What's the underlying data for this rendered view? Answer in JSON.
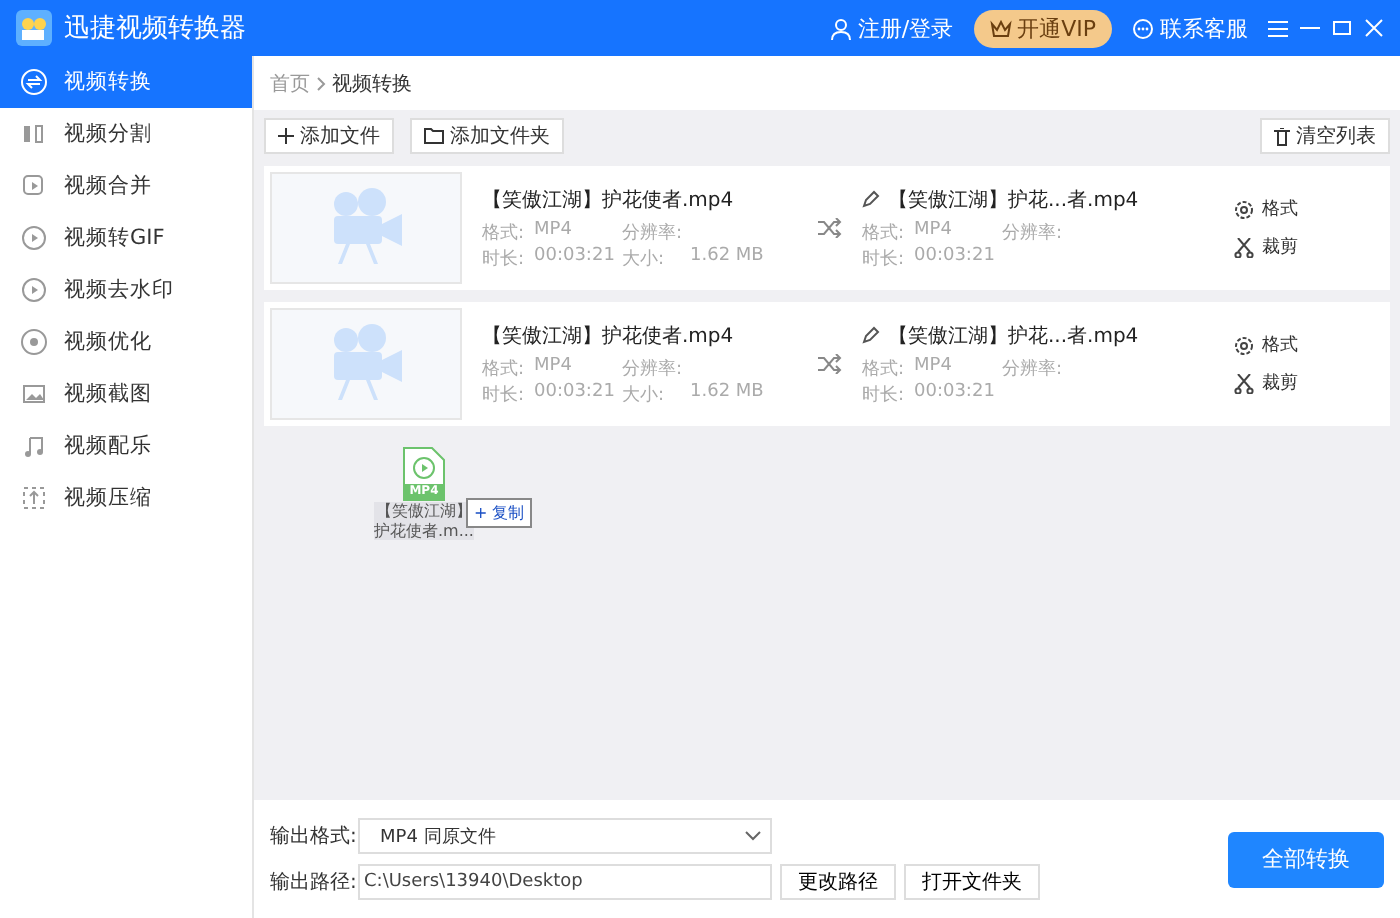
{
  "window": {
    "title": "迅捷视频转换器"
  },
  "header": {
    "login": "注册/登录",
    "vip": "开通VIP",
    "support": "联系客服"
  },
  "sidebar": {
    "items": [
      {
        "label": "视频转换",
        "selected": true
      },
      {
        "label": "视频分割",
        "selected": false
      },
      {
        "label": "视频合并",
        "selected": false
      },
      {
        "label": "视频转GIF",
        "selected": false
      },
      {
        "label": "视频去水印",
        "selected": false
      },
      {
        "label": "视频优化",
        "selected": false
      },
      {
        "label": "视频截图",
        "selected": false
      },
      {
        "label": "视频配乐",
        "selected": false
      },
      {
        "label": "视频压缩",
        "selected": false
      }
    ]
  },
  "breadcrumb": [
    "首页",
    "视频转换"
  ],
  "toolbar": {
    "add_file": "添加文件",
    "add_folder": "添加文件夹",
    "clear": "清空列表"
  },
  "files": [
    {
      "name": "【笑傲江湖】护花使者.mp4",
      "format_label": "格式:",
      "format": "MP4",
      "resolution_label": "分辨率:",
      "duration_label": "时长:",
      "duration": "00:03:21",
      "size_label": "大小:",
      "size": "1.62 MB",
      "output_name": "【笑傲江湖】护花...者.mp4",
      "output_format_label": "格式:",
      "output_format": "MP4",
      "output_resolution_label": "分辨率:",
      "output_duration_label": "时长:",
      "output_duration": "00:03:21",
      "actions": [
        "格式",
        "裁剪"
      ]
    },
    {
      "name": "【笑傲江湖】护花使者.mp4",
      "format_label": "格式:",
      "format": "MP4",
      "resolution_label": "分辨率:",
      "duration_label": "时长:",
      "duration": "00:03:21",
      "size_label": "大小:",
      "size": "1.62 MB",
      "output_name": "【笑傲江湖】护花...者.mp4",
      "output_format_label": "格式:",
      "output_format": "MP4",
      "output_resolution_label": "分辨率:",
      "output_duration_label": "时长:",
      "output_duration": "00:03:21",
      "actions": [
        "格式",
        "裁剪"
      ]
    }
  ],
  "drag": {
    "badge": "MP4",
    "label": [
      "【笑傲江湖】",
      "护花使者.m..."
    ],
    "hint": "+ 复制"
  },
  "output": {
    "format_label": "输出格式:",
    "format": "MP4  同原文件",
    "path_label": "输出路径:",
    "path": "C:\\Users\\13940\\Desktop",
    "change": "更改路径",
    "open": "打开文件夹",
    "convert_all": "全部转换"
  }
}
